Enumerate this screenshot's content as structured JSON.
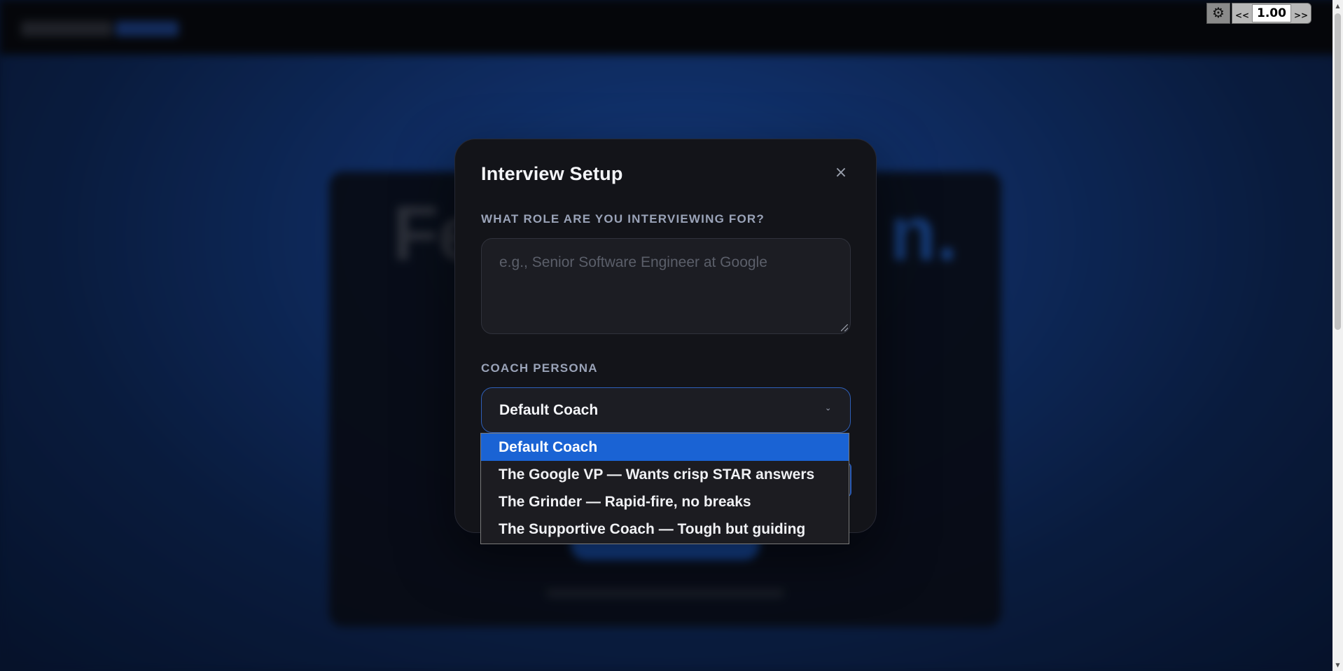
{
  "modal": {
    "title": "Interview Setup",
    "close_label": "×",
    "role_label": "What role are you interviewing for?",
    "role_value": "",
    "role_placeholder": "e.g., Senior Software Engineer at Google",
    "persona_label": "Coach Persona",
    "persona_selected": "Default Coach"
  },
  "dropdown": {
    "options": [
      "Default Coach",
      "The Google VP — Wants crisp STAR answers",
      "The Grinder — Rapid-fire, no breaks",
      "The Supportive Coach — Tough but guiding"
    ],
    "selected_index": 0
  },
  "playback": {
    "gear_icon": "gear-icon",
    "prev_label": "<<",
    "speed_value": "1.00",
    "next_label": ">>"
  },
  "colors": {
    "accent": "#1a63d4",
    "modal_bg": "#131419",
    "field_bg": "#1c1d23",
    "label": "#9aa3b8"
  }
}
